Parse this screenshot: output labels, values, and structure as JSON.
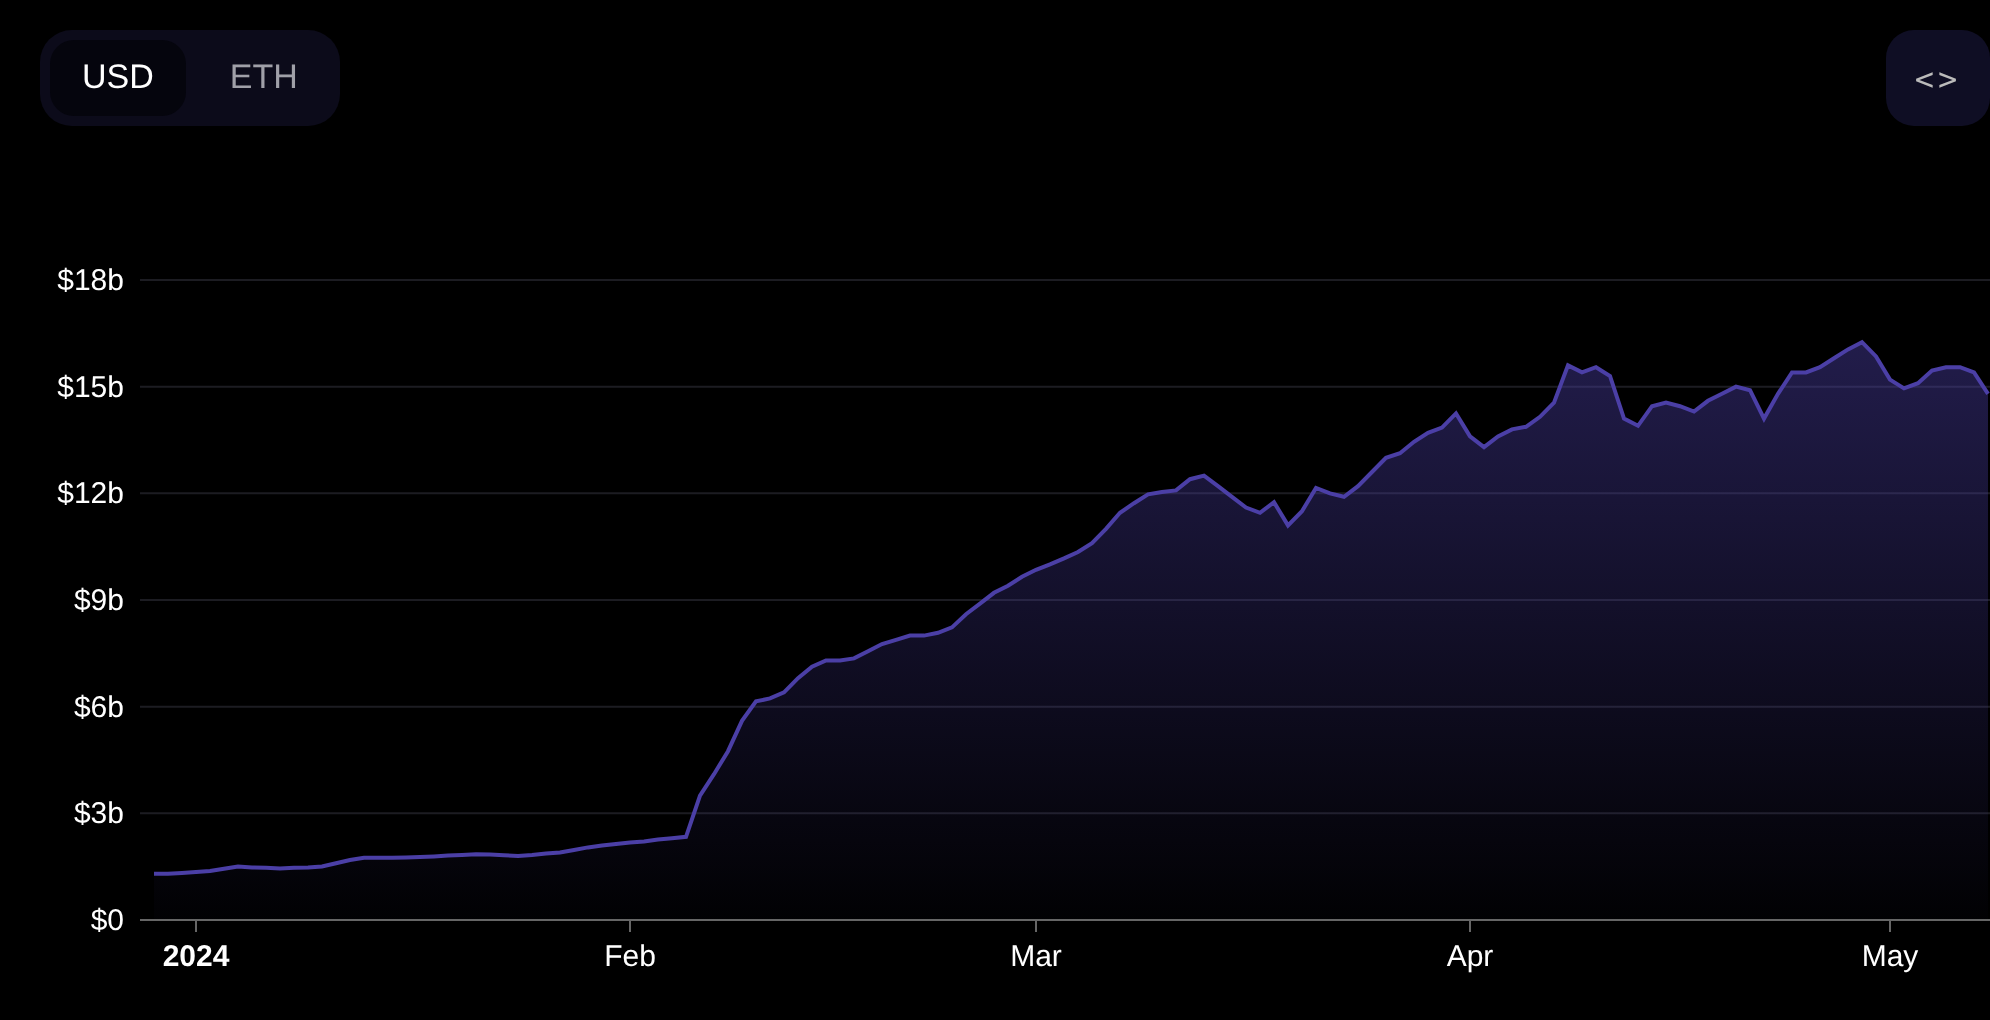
{
  "currency_toggle": [
    {
      "label": "USD",
      "selected": true
    },
    {
      "label": "ETH",
      "selected": false
    }
  ],
  "embed_button": {
    "label": "<>"
  },
  "chart_data": {
    "type": "area",
    "grid": true,
    "ylim": [
      0,
      18
    ],
    "yticks": [
      {
        "value": 0,
        "label": "$0"
      },
      {
        "value": 3,
        "label": "$3b"
      },
      {
        "value": 6,
        "label": "$6b"
      },
      {
        "value": 9,
        "label": "$9b"
      },
      {
        "value": 12,
        "label": "$12b"
      },
      {
        "value": 15,
        "label": "$15b"
      },
      {
        "value": 18,
        "label": "$18b"
      }
    ],
    "categories": [
      null,
      null,
      null,
      "2024",
      null,
      null,
      null,
      null,
      null,
      null,
      null,
      null,
      null,
      null,
      null,
      null,
      null,
      null,
      null,
      null,
      null,
      null,
      null,
      null,
      null,
      null,
      null,
      null,
      null,
      null,
      null,
      null,
      null,
      null,
      "Feb",
      null,
      null,
      null,
      null,
      null,
      null,
      null,
      null,
      null,
      null,
      null,
      null,
      null,
      null,
      null,
      null,
      null,
      null,
      null,
      null,
      null,
      null,
      null,
      null,
      null,
      null,
      null,
      null,
      "Mar",
      null,
      null,
      null,
      null,
      null,
      null,
      null,
      null,
      null,
      null,
      null,
      null,
      null,
      null,
      null,
      null,
      null,
      null,
      null,
      null,
      null,
      null,
      null,
      null,
      null,
      null,
      null,
      null,
      null,
      null,
      "Apr",
      null,
      null,
      null,
      null,
      null,
      null,
      null,
      null,
      null,
      null,
      null,
      null,
      null,
      null,
      null,
      null,
      null,
      null,
      null,
      null,
      null,
      null,
      null,
      null,
      null,
      null,
      null,
      null,
      null,
      "May",
      null,
      null,
      null,
      null,
      null,
      null,
      null
    ],
    "series": [
      {
        "color": "#4b3fa6",
        "values": [
          1.3,
          1.3,
          1.32,
          1.35,
          1.38,
          1.44,
          1.5,
          1.48,
          1.47,
          1.45,
          1.47,
          1.48,
          1.51,
          1.6,
          1.69,
          1.75,
          1.75,
          1.75,
          1.76,
          1.77,
          1.79,
          1.81,
          1.83,
          1.85,
          1.84,
          1.82,
          1.8,
          1.83,
          1.87,
          1.9,
          1.97,
          2.04,
          2.1,
          2.14,
          2.18,
          2.21,
          2.26,
          2.3,
          2.34,
          3.5,
          4.1,
          4.75,
          5.6,
          6.15,
          6.23,
          6.4,
          6.8,
          7.12,
          7.3,
          7.3,
          7.36,
          7.56,
          7.76,
          7.88,
          8,
          8,
          8.08,
          8.23,
          8.6,
          8.9,
          9.2,
          9.4,
          9.65,
          9.85,
          10,
          10.17,
          10.35,
          10.6,
          11,
          11.45,
          11.72,
          11.97,
          12.04,
          12.08,
          12.4,
          12.5,
          12.2,
          11.9,
          11.6,
          11.45,
          11.75,
          11.1,
          11.5,
          12.15,
          12,
          11.9,
          12.2,
          12.6,
          13,
          13.13,
          13.45,
          13.7,
          13.85,
          14.25,
          13.6,
          13.3,
          13.6,
          13.8,
          13.87,
          14.15,
          14.55,
          15.6,
          15.4,
          15.55,
          15.3,
          14.1,
          13.9,
          14.45,
          14.55,
          14.45,
          14.3,
          14.6,
          14.8,
          15,
          14.9,
          14.1,
          14.8,
          15.4,
          15.4,
          15.55,
          15.8,
          16.05,
          16.25,
          15.85,
          15.2,
          14.95,
          15.1,
          15.45,
          15.55,
          15.55,
          15.4,
          14.8
        ]
      }
    ]
  }
}
